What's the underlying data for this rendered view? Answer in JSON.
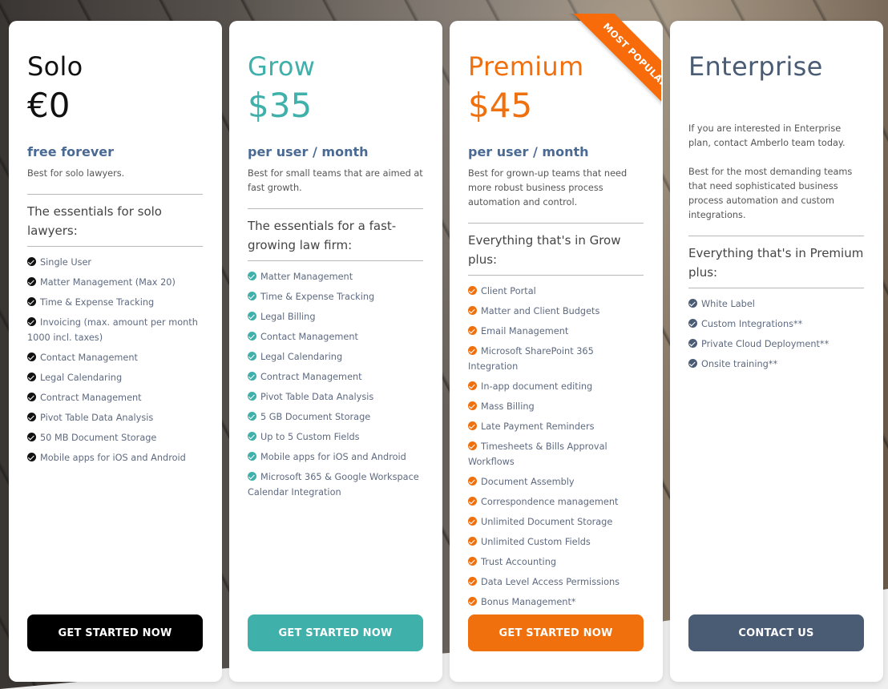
{
  "colors": {
    "solo": "#111111",
    "grow": "#3fb0aa",
    "premium": "#f0700e",
    "enterprise": "#4a5b74",
    "period_text": "#4a6a94",
    "ribbon": "#f76b0a"
  },
  "ribbon": {
    "label": "MOST POPULAR"
  },
  "plans": [
    {
      "name": "Solo",
      "price": "€0",
      "period": "free forever",
      "description": "Best for solo lawyers.",
      "section_title": "The essentials for solo lawyers:",
      "check_icon": "check-circle-icon",
      "features": [
        "Single User",
        "Matter Management (Max 20)",
        "Time & Expense Tracking",
        "Invoicing (max. amount per month 1000 incl. taxes)",
        "Contact Management",
        "Legal Calendaring",
        "Contract Management",
        "Pivot Table Data Analysis",
        "50 MB Document Storage",
        "Mobile apps for iOS and Android"
      ],
      "cta": "GET STARTED NOW"
    },
    {
      "name": "Grow",
      "price": "$35",
      "period": "per user / month",
      "description": "Best for small teams that are aimed at fast growth.",
      "section_title": "The essentials for a fast-growing law firm:",
      "check_icon": "check-circle-icon",
      "features": [
        "Matter Management",
        "Time & Expense Tracking",
        "Legal Billing",
        "Contact Management",
        "Legal Calendaring",
        "Contract Management",
        "Pivot Table Data Analysis",
        "5 GB Document Storage",
        "Up to 5 Custom Fields",
        "Mobile apps for iOS and Android",
        "Microsoft 365 & Google Workspace Calendar Integration"
      ],
      "cta": "GET STARTED NOW"
    },
    {
      "name": "Premium",
      "price": "$45",
      "period": "per user / month",
      "description": "Best for grown-up teams that need more robust business process automation and control.",
      "section_title": "Everything that's in Grow plus:",
      "check_icon": "check-circle-icon",
      "features": [
        "Client Portal",
        "Matter and Client Budgets",
        "Email Management",
        "Microsoft SharePoint 365 Integration",
        "In-app document editing",
        "Mass Billing",
        "Late Payment Reminders",
        "Timesheets & Bills Approval Workflows",
        "Document Assembly",
        "Correspondence management",
        "Unlimited Document Storage",
        "Unlimited Custom Fields",
        "Trust Accounting",
        "Data Level Access Permissions",
        "Bonus Management*"
      ],
      "cta": "GET STARTED NOW"
    },
    {
      "name": "Enterprise",
      "description": "If you are interested in Enterprise plan, contact Amberlo team today.",
      "description2": "Best for the most demanding teams that need sophisticated business process automation and custom integrations.",
      "section_title": "Everything that's in Premium plus:",
      "check_icon": "check-circle-icon",
      "features": [
        "White Label",
        "Custom Integrations**",
        "Private Cloud Deployment**",
        "Onsite training**"
      ],
      "cta": "CONTACT US"
    }
  ]
}
